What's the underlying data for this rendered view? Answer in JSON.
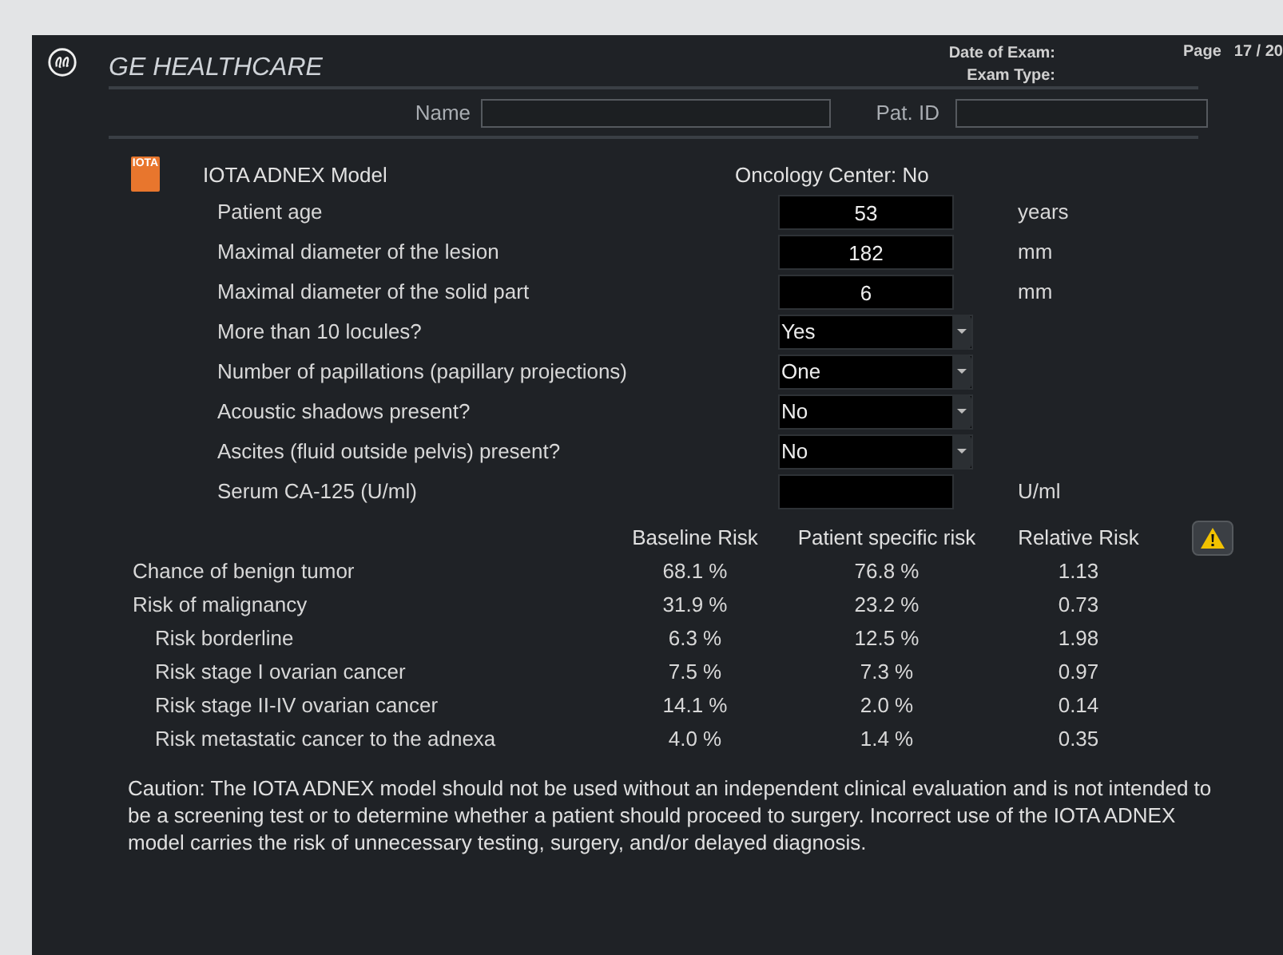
{
  "header": {
    "brand": "GE HEALTHCARE",
    "meta": [
      "Date of Exam:",
      "Exam Type:"
    ],
    "page_label": "Page",
    "page": "17 / 20"
  },
  "patient": {
    "name_label": "Name",
    "id_label": "Pat. ID"
  },
  "model": {
    "logo_text": "IOTA",
    "title": "IOTA ADNEX Model",
    "oncology_center": "Oncology Center: No"
  },
  "fields": [
    {
      "label": "Patient age",
      "kind": "number",
      "value": "53",
      "unit": "years"
    },
    {
      "label": "Maximal diameter of the lesion",
      "kind": "number",
      "value": "182",
      "unit": "mm"
    },
    {
      "label": "Maximal diameter of the solid part",
      "kind": "number",
      "value": "6",
      "unit": "mm"
    },
    {
      "label": "More than 10 locules?",
      "kind": "select",
      "value": "Yes"
    },
    {
      "label": "Number of papillations (papillary projections)",
      "kind": "select",
      "value": "One"
    },
    {
      "label": "Acoustic shadows present?",
      "kind": "select",
      "value": "No"
    },
    {
      "label": "Ascites (fluid outside pelvis) present?",
      "kind": "select",
      "value": "No"
    },
    {
      "label": "Serum CA-125 (U/ml)",
      "kind": "number",
      "unit": "U/ml"
    }
  ],
  "risk_table": {
    "columns": [
      "Baseline Risk",
      "Patient specific risk",
      "Relative Risk"
    ],
    "rows": [
      {
        "label": "Chance of benign tumor",
        "values": [
          "68.1 %",
          "76.8 %",
          "1.13"
        ]
      },
      {
        "label": "Risk of malignancy",
        "values": [
          "31.9 %",
          "23.2 %",
          "0.73"
        ],
        "children": [
          {
            "label": "Risk borderline",
            "values": [
              "6.3 %",
              "12.5 %",
              "1.98"
            ]
          },
          {
            "label": "Risk stage I ovarian cancer",
            "values": [
              "7.5 %",
              "7.3 %",
              "0.97"
            ]
          },
          {
            "label": "Risk stage II-IV ovarian cancer",
            "values": [
              "14.1 %",
              "2.0 %",
              "0.14"
            ]
          },
          {
            "label": "Risk metastatic cancer to the adnexa",
            "values": [
              "4.0 %",
              "1.4 %",
              "0.35"
            ]
          }
        ]
      }
    ]
  },
  "caution": "Caution: The IOTA ADNEX model should not be used without an independent clinical evaluation and is not intended to be a screening test or to determine whether a patient should proceed to surgery. Incorrect use of the IOTA ADNEX model carries the risk of unnecessary testing, surgery, and/or delayed diagnosis."
}
